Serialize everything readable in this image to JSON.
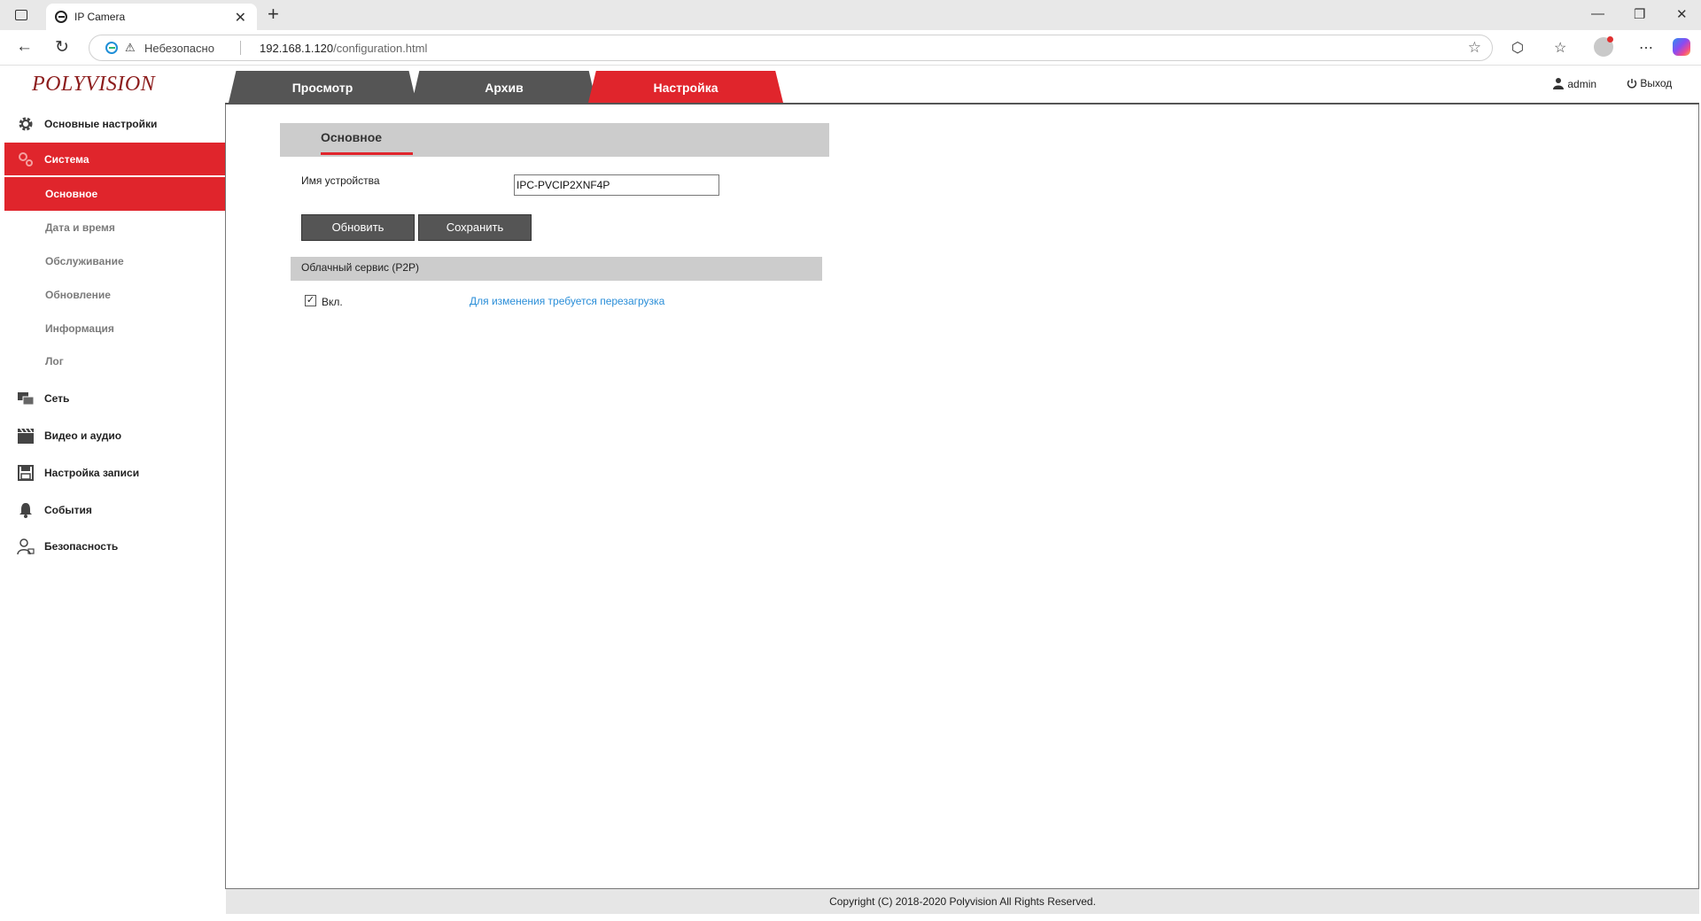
{
  "browser": {
    "tab_title": "IP Camera",
    "tab_close": "✕",
    "new_tab": "+",
    "security_label": "Небезопасно",
    "url_host": "192.168.1.120",
    "url_path": "/configuration.html",
    "window_controls": {
      "minimize": "—",
      "restore": "❐",
      "close": "✕"
    }
  },
  "header": {
    "logo": "POLYVISION",
    "tabs": [
      {
        "label": "Просмотр"
      },
      {
        "label": "Архив"
      },
      {
        "label": "Настройка",
        "active": true
      }
    ],
    "user": "admin",
    "logout": "Выход"
  },
  "sidebar": {
    "items": [
      {
        "label": "Основные настройки",
        "icon": "gear-icon"
      },
      {
        "label": "Система",
        "icon": "gears-icon",
        "active": true
      },
      {
        "label": "Сеть",
        "icon": "network-icon"
      },
      {
        "label": "Видео и аудио",
        "icon": "clapperboard-icon"
      },
      {
        "label": "Настройка записи",
        "icon": "floppy-icon"
      },
      {
        "label": "События",
        "icon": "bell-icon"
      },
      {
        "label": "Безопасность",
        "icon": "user-lock-icon"
      }
    ],
    "subitems": [
      {
        "label": "Основное",
        "active": true
      },
      {
        "label": "Дата и время"
      },
      {
        "label": "Обслуживание"
      },
      {
        "label": "Обновление"
      },
      {
        "label": "Информация"
      },
      {
        "label": "Лог"
      }
    ]
  },
  "content": {
    "section_tab": "Основное",
    "device_name_label": "Имя устройства",
    "device_name_value": "IPC-PVCIP2XNF4P",
    "refresh_button": "Обновить",
    "save_button": "Сохранить",
    "p2p_title": "Облачный сервис (P2P)",
    "p2p_enabled_label": "Вкл.",
    "p2p_enabled": true,
    "reboot_note": "Для изменения требуется перезагрузка"
  },
  "footer": {
    "copyright": "Copyright (C) 2018-2020 Polyvision All Rights Reserved."
  },
  "colors": {
    "accent_red": "#e0252c",
    "tab_gray": "#555555",
    "link_blue": "#2a8ed8"
  }
}
